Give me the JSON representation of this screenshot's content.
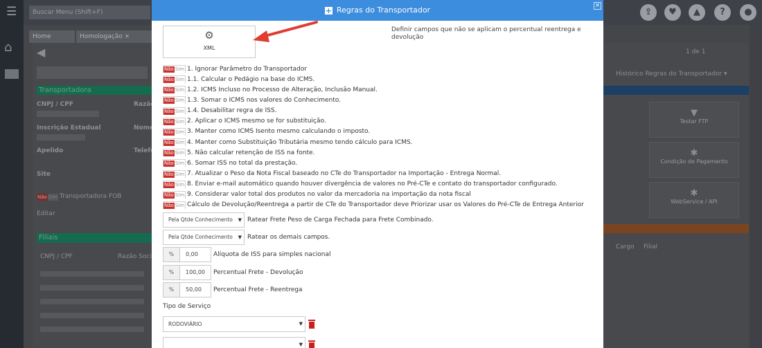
{
  "background": {
    "search_placeholder": "Buscar Menu  (Shift+F)",
    "tabs": [
      "Home",
      "Homologação ×"
    ],
    "section_title": "Transportadora",
    "labels": [
      "CNPJ / CPF",
      "Razão",
      "Inscrição Estadual",
      "Nome",
      "Apelido",
      "Telefo",
      "Site"
    ],
    "toggle_no": "Não",
    "toggle_yes": "Sim",
    "fob_label": "Transportadora FOB",
    "edit_link": "Editar",
    "filiais_title": "Filiais",
    "filiais_cols": [
      "CNPJ / CPF",
      "Razão Social"
    ],
    "pagination": "1 de 1",
    "history_dropdown": "Histórico Regras do Transportador ▾",
    "tiles": [
      "Testar FTP",
      "Condição de Pagamento",
      "WebService / API"
    ],
    "right_cols": [
      "Cargo",
      "Filial"
    ]
  },
  "modal": {
    "title": "Regras do Transportador",
    "close_label": "×",
    "xml_button_label": "XML",
    "define_text": "Definir campos que não se aplicam o percentual reentrega e devolução",
    "toggle_no": "Não",
    "toggle_yes": "Sim",
    "rules": [
      "1. Ignorar Parâmetro do Transportador",
      "1.1. Calcular o Pedágio na base do ICMS.",
      "1.2. ICMS Incluso no Processo de Alteração, Inclusão Manual.",
      "1.3. Somar o ICMS nos valores do Conhecimento.",
      "1.4. Desabilitar regra de ISS.",
      "2. Aplicar o ICMS mesmo se for substituição.",
      "3. Manter como ICMS Isento mesmo calculando o imposto.",
      "4. Manter como Substituição Tributária mesmo tendo cálculo para ICMS.",
      "5. Não calcular retenção de ISS na fonte.",
      "6. Somar ISS no total da prestação.",
      "7. Atualizar o Peso da Nota Fiscal baseado no CTe do Transportador na Importação - Entrega Normal.",
      "8. Enviar e-mail automático quando houver divergência de valores no Pré-CTe e contato do transportador configurado.",
      "9. Considerar valor total dos produtos no valor da mercadoria na importação da nota fiscal",
      "Cálculo de Devolução/Reentrega a partir de CTe do Transportador deve Priorizar usar os Valores do Pré-CTe de Entrega Anterior"
    ],
    "rateio_1": {
      "value": "Pela Qtde Conhecimento",
      "label": "Ratear Frete Peso de Carga Fechada para Frete Combinado."
    },
    "rateio_2": {
      "value": "Pela Qtde Conhecimento",
      "label": "Ratear os demais campos."
    },
    "percent_symbol": "%",
    "iss_rate": {
      "value": "0,00",
      "label": "Alíquota de ISS para simples nacional"
    },
    "freight_return": {
      "value": "100,00",
      "label": "Percentual Frete - Devolução"
    },
    "freight_redelivery": {
      "value": "50,00",
      "label": "Percentual Frete - Reentrega"
    },
    "service_type_label": "Tipo de Serviço",
    "service_types": [
      "RODOVIÁRIO",
      ""
    ]
  },
  "colors": {
    "header_blue": "#3c8dde",
    "toggle_red": "#c9302c",
    "arrow_red": "#e03c31",
    "trash_red": "#cc1f1a"
  }
}
